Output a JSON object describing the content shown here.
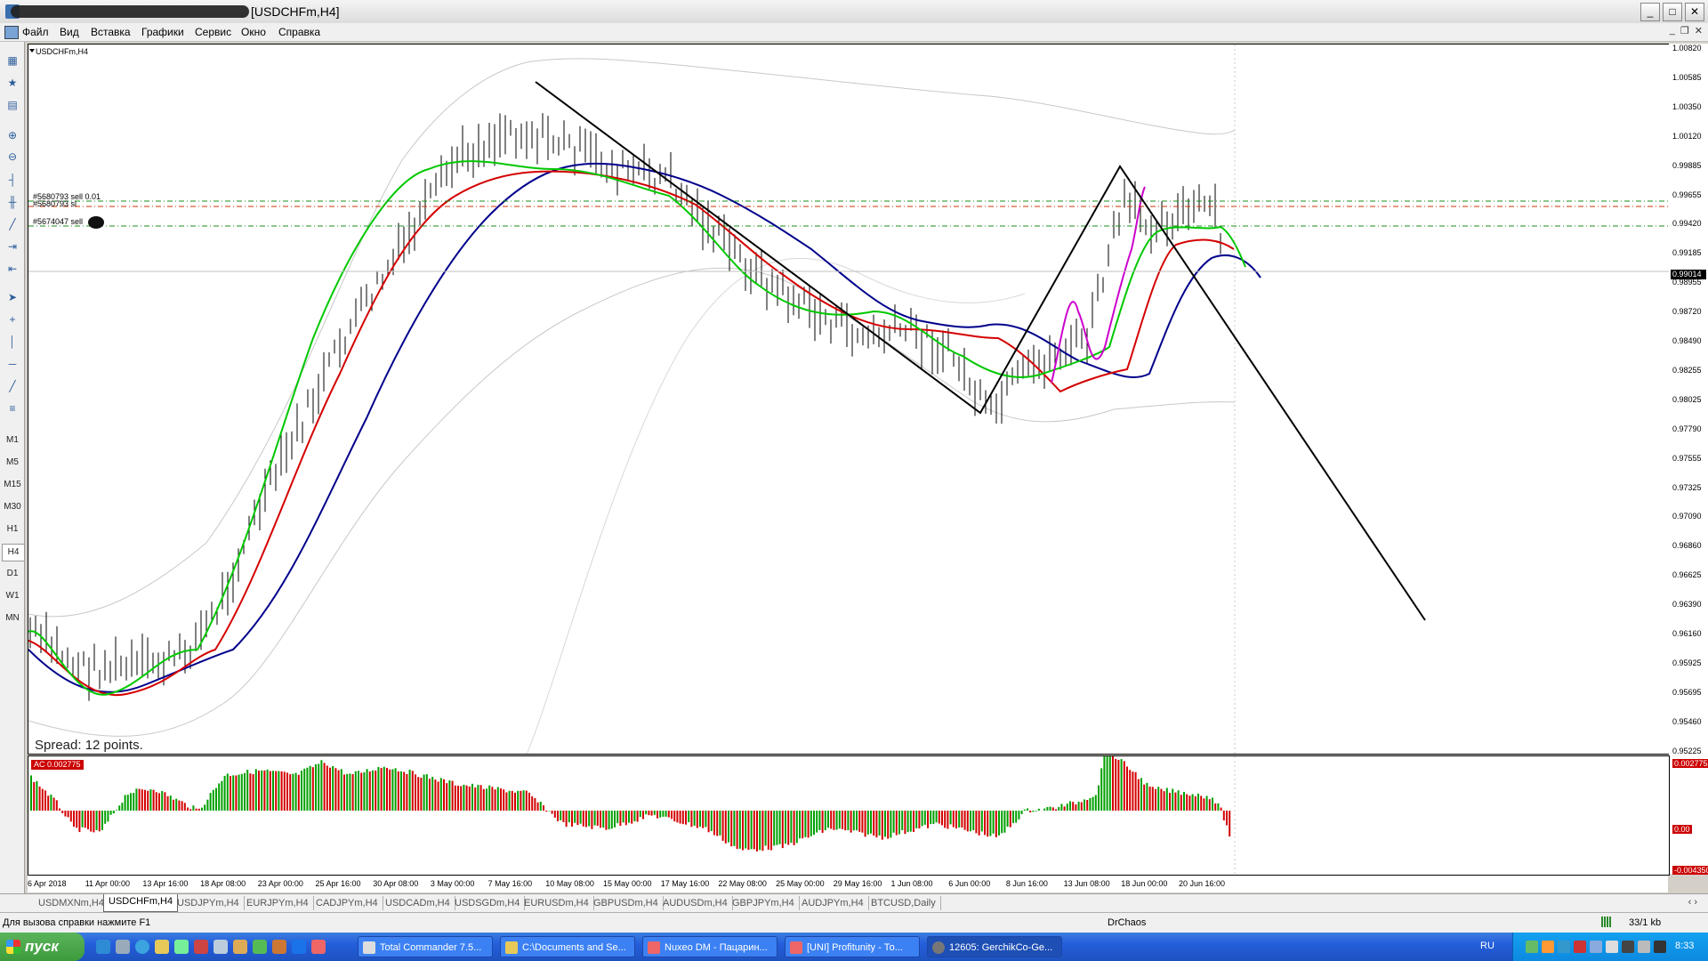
{
  "window": {
    "title": "[USDCHFm,H4]",
    "btn_min": "_",
    "btn_max": "□",
    "btn_close": "✕"
  },
  "menu": [
    "Файл",
    "Вид",
    "Вставка",
    "Графики",
    "Сервис",
    "Окно",
    "Справка"
  ],
  "toolbar_timeframes": [
    "M1",
    "M5",
    "M15",
    "M30",
    "H1",
    "H4",
    "D1",
    "W1",
    "MN"
  ],
  "chart": {
    "symbol_label": "USDCHFm,H4",
    "spread_label": "Spread: 12 points.",
    "order_lines": [
      "#5680793 sell 0.01",
      "#5680793 sl",
      "#5674047 sell"
    ],
    "current_price": "0.99014",
    "price_labels": [
      "1.00820",
      "1.00585",
      "1.00350",
      "1.00120",
      "0.99885",
      "0.99655",
      "0.99420",
      "0.99185",
      "0.98955",
      "0.98720",
      "0.98490",
      "0.98255",
      "0.98025",
      "0.97790",
      "0.97555",
      "0.97325",
      "0.97090",
      "0.96860",
      "0.96625",
      "0.96390",
      "0.96160",
      "0.95925",
      "0.95695",
      "0.95460",
      "0.95225"
    ],
    "colors": {
      "green": "#00c800",
      "red": "#d40000",
      "blue": "#00008b",
      "magenta": "#cc00cc",
      "gray": "#c8c8c8",
      "order_green": "#1a8c1a",
      "order_red": "#cc3300"
    }
  },
  "indicator": {
    "label": "AC  0.002775",
    "axis_top": "0.002775",
    "axis_mid": "0.00",
    "axis_bottom": "-0.004350"
  },
  "time_labels": [
    "6 Apr 2018",
    "11 Apr 00:00",
    "13 Apr 16:00",
    "18 Apr 08:00",
    "23 Apr 00:00",
    "25 Apr 16:00",
    "30 Apr 08:00",
    "3 May 00:00",
    "7 May 16:00",
    "10 May 08:00",
    "15 May 00:00",
    "17 May 16:00",
    "22 May 08:00",
    "25 May 00:00",
    "29 May 16:00",
    "1 Jun 08:00",
    "6 Jun 00:00",
    "8 Jun 16:00",
    "13 Jun 08:00",
    "18 Jun 00:00",
    "20 Jun 16:00"
  ],
  "tabs": [
    "USDMXNm,H4",
    "USDCHFm,H4",
    "USDJPYm,H4",
    "EURJPYm,H4",
    "CADJPYm,H4",
    "USDCADm,H4",
    "USDSGDm,H4",
    "EURUSDm,H4",
    "GBPUSDm,H4",
    "AUDUSDm,H4",
    "GBPJPYm,H4",
    "AUDJPYm,H4",
    "BTCUSD,Daily"
  ],
  "tabs_nav": "‹ ›",
  "status": {
    "help": "Для вызова справки нажмите F1",
    "profile": "DrChaos",
    "traffic": "33/1 kb"
  },
  "taskbar": {
    "start": "пуск",
    "tasks": [
      "Total Commander 7.5...",
      "C:\\Documents and Se...",
      "Nuxeo DM - Пацарин...",
      "[UNI] Profitunity - То...",
      "12605: GerchikCo-Ge..."
    ],
    "lang": "RU",
    "clock": "8:33"
  }
}
